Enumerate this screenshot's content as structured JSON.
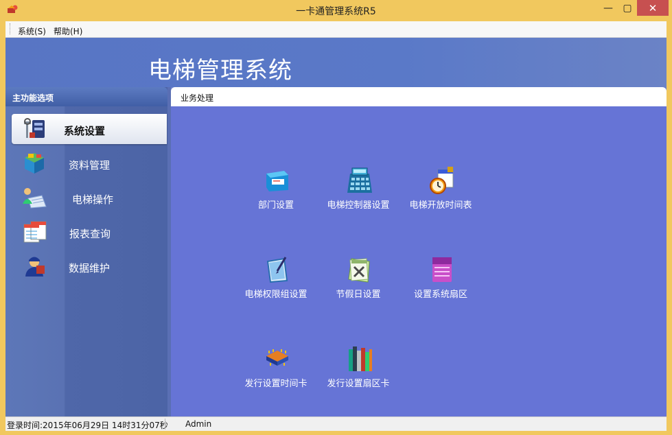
{
  "window": {
    "title": "一卡通管理系统R5",
    "close_glyph": "✕",
    "min_glyph": "—",
    "max_glyph": "▢"
  },
  "menu": {
    "items": [
      "系统(S)",
      "帮助(H)"
    ]
  },
  "banner": {
    "title": "电梯管理系统"
  },
  "sidebar": {
    "header": "主功能选项",
    "items": [
      {
        "label": "系统设置",
        "icon": "system-settings-icon",
        "active": true
      },
      {
        "label": "资料管理",
        "icon": "data-management-icon",
        "active": false
      },
      {
        "label": "电梯操作",
        "icon": "elevator-operation-icon",
        "active": false
      },
      {
        "label": "报表查询",
        "icon": "report-query-icon",
        "active": false
      },
      {
        "label": "数据维护",
        "icon": "data-maintenance-icon",
        "active": false
      }
    ]
  },
  "content": {
    "header": "业务处理",
    "tiles": [
      {
        "label": "部门设置",
        "icon": "department-icon"
      },
      {
        "label": "电梯控制器设置",
        "icon": "calculator-icon"
      },
      {
        "label": "电梯开放时间表",
        "icon": "clock-calendar-icon"
      },
      {
        "label": "电梯权限组设置",
        "icon": "notepad-pen-icon"
      },
      {
        "label": "节假日设置",
        "icon": "holiday-calendar-icon"
      },
      {
        "label": "设置系统扇区",
        "icon": "sector-card-icon"
      },
      {
        "label": "发行设置时间卡",
        "icon": "chip-card-icon"
      },
      {
        "label": "发行设置扇区卡",
        "icon": "books-icon"
      }
    ]
  },
  "status": {
    "login": "登录时间:2015年06月29日 14时31分07秒",
    "user": "Admin"
  },
  "colors": {
    "title_bar": "#f1c85e",
    "banner": "#5875c4",
    "content": "#6674d6",
    "close": "#c75050"
  }
}
